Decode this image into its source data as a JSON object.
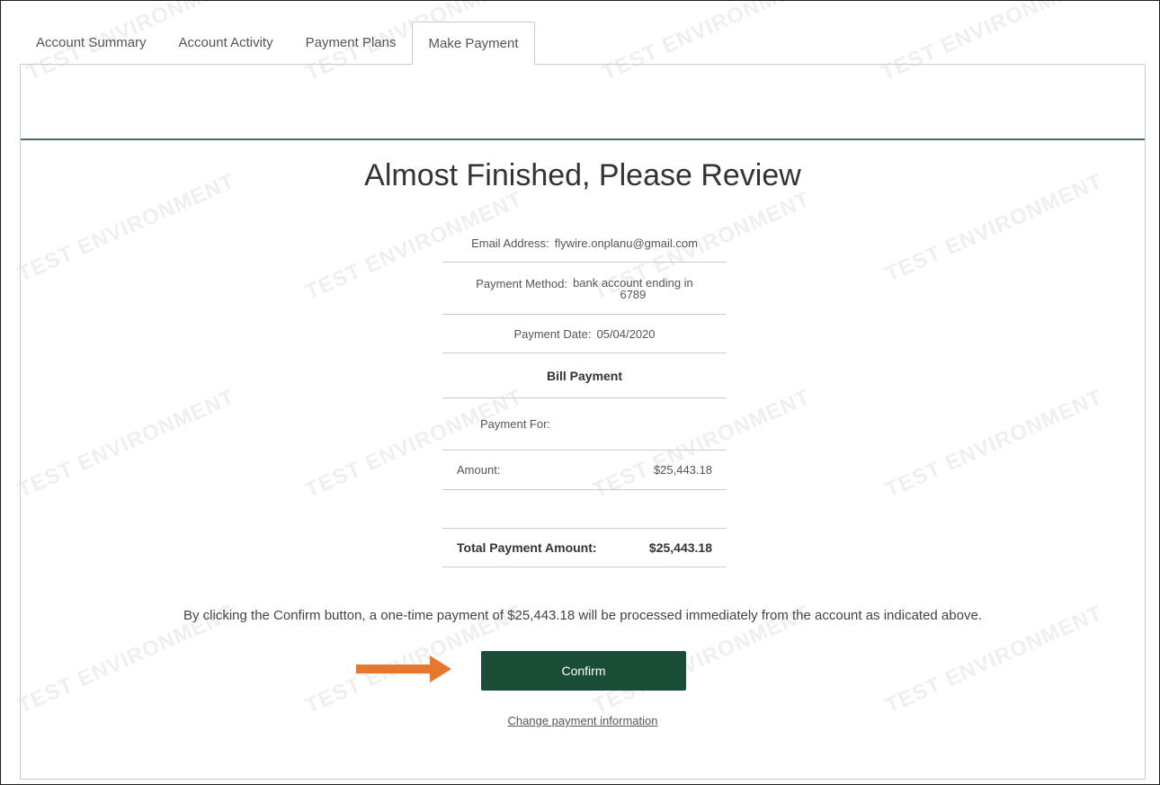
{
  "tabs": [
    {
      "label": "Account Summary"
    },
    {
      "label": "Account Activity"
    },
    {
      "label": "Payment Plans"
    },
    {
      "label": "Make Payment"
    }
  ],
  "review": {
    "title": "Almost Finished, Please Review",
    "email_label": "Email Address:",
    "email_value": "flywire.onplanu@gmail.com",
    "method_label": "Payment Method:",
    "method_value_line1": "bank account ending in",
    "method_value_line2": "6789",
    "date_label": "Payment Date:",
    "date_value": "05/04/2020",
    "section_heading": "Bill Payment",
    "payment_for_label": "Payment For:",
    "amount_label": "Amount:",
    "amount_value": "$25,443.18",
    "total_label": "Total Payment Amount:",
    "total_value": "$25,443.18"
  },
  "notice": "By clicking the Confirm button, a one-time payment of $25,443.18 will be processed immediately from the account as indicated above.",
  "confirm_label": "Confirm",
  "change_link": "Change payment information",
  "watermark": "TEST ENVIRONMENT",
  "colors": {
    "confirm_bg": "#1a4d36",
    "rule": "#4f6d62",
    "arrow": "#e8772e"
  }
}
